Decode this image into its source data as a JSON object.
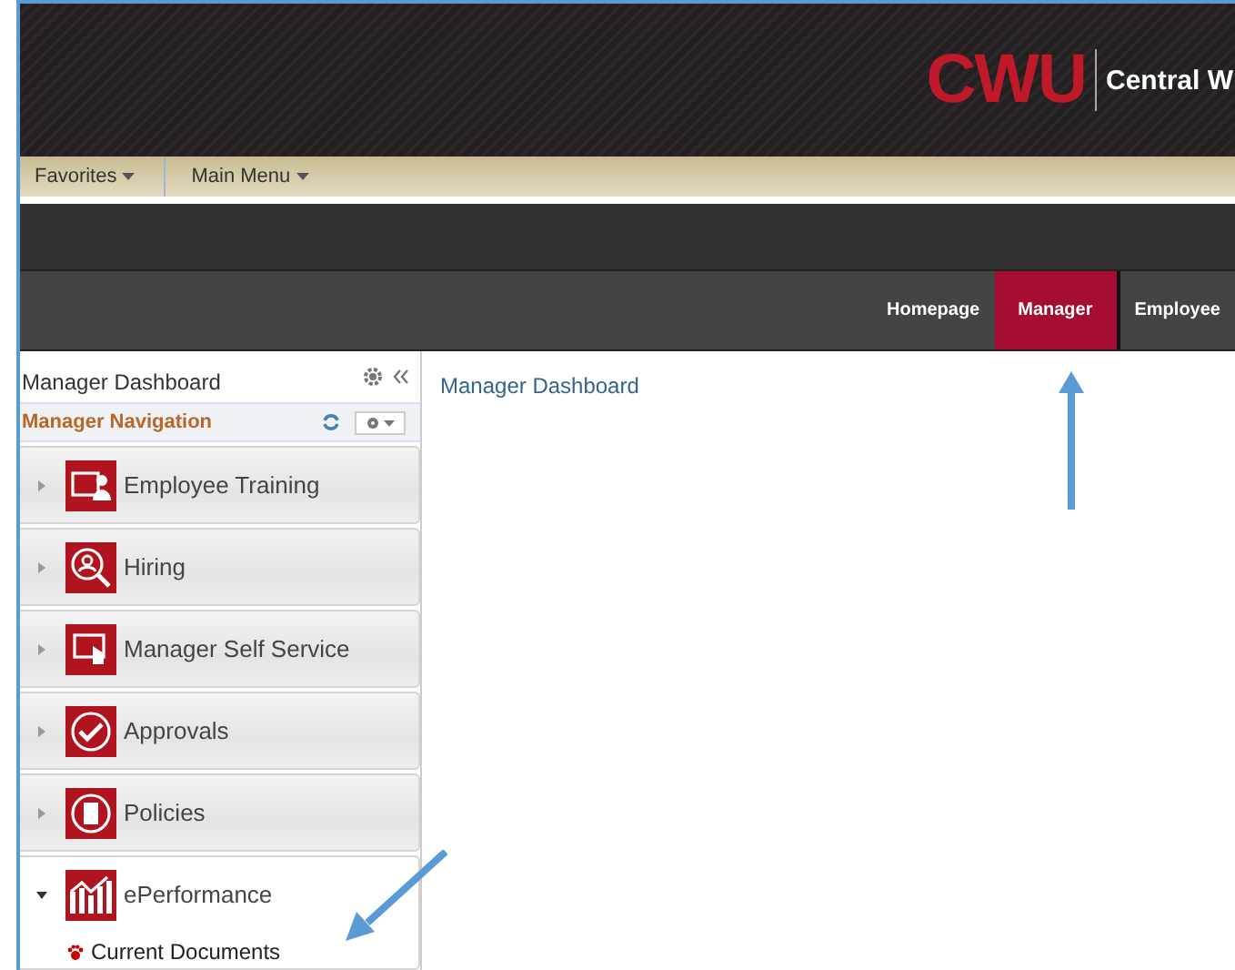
{
  "header": {
    "logo": "CWU",
    "title": "Central W"
  },
  "menubar": [
    {
      "label": "Favorites"
    },
    {
      "label": "Main Menu"
    }
  ],
  "tabs": [
    {
      "label": "Homepage",
      "selected": false
    },
    {
      "label": "Manager",
      "selected": true
    },
    {
      "label": "Employee",
      "selected": false
    }
  ],
  "sidebar": {
    "title": "Manager Dashboard",
    "section": "Manager Navigation",
    "items": [
      {
        "label": "Employee Training",
        "kind": "training",
        "expanded": false
      },
      {
        "label": "Hiring",
        "kind": "hiring",
        "expanded": false
      },
      {
        "label": "Manager Self Service",
        "kind": "selfservice",
        "expanded": false
      },
      {
        "label": "Approvals",
        "kind": "approvals",
        "expanded": false
      },
      {
        "label": "Policies",
        "kind": "policies",
        "expanded": false
      },
      {
        "label": "ePerformance",
        "kind": "performance",
        "expanded": true,
        "children": [
          {
            "label": "Current Documents"
          }
        ]
      }
    ]
  },
  "content": {
    "title": "Manager Dashboard"
  }
}
